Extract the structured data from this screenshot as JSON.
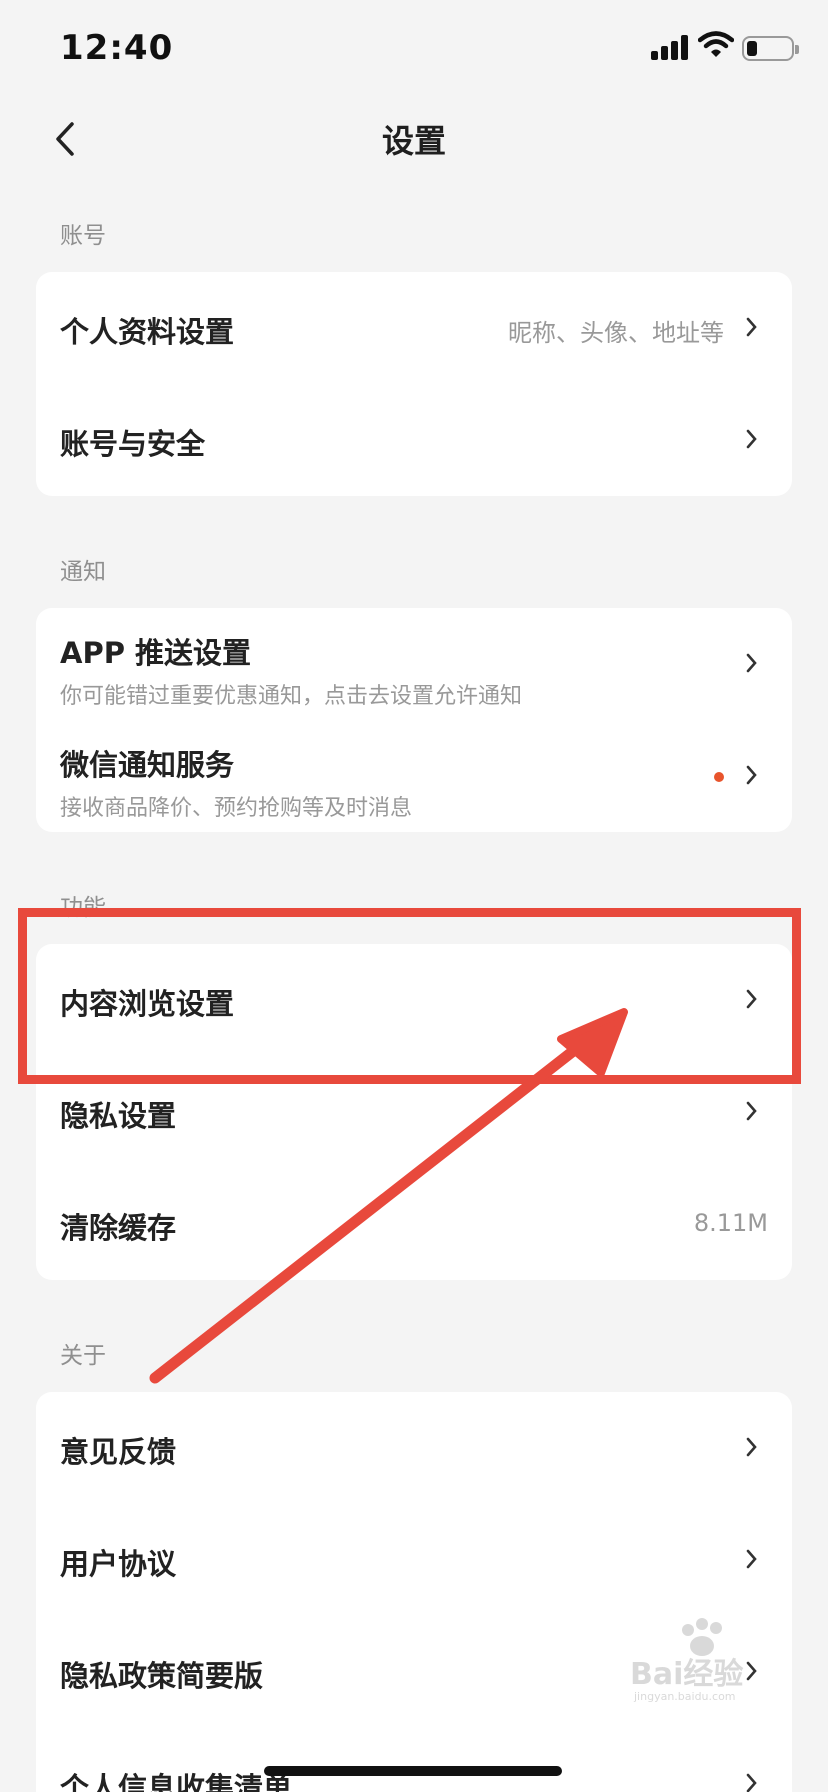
{
  "status_bar": {
    "time": "12:40"
  },
  "nav": {
    "title": "设置"
  },
  "sections": {
    "account": {
      "label": "账号",
      "rows": [
        {
          "title": "个人资料设置",
          "value": "昵称、头像、地址等"
        },
        {
          "title": "账号与安全"
        }
      ]
    },
    "notify": {
      "label": "通知",
      "rows": [
        {
          "title": "APP 推送设置",
          "sub": "你可能错过重要优惠通知，点击去设置允许通知"
        },
        {
          "title": "微信通知服务",
          "sub": "接收商品降价、预约抢购等及时消息"
        }
      ]
    },
    "features": {
      "label": "功能",
      "rows": [
        {
          "title": "内容浏览设置"
        },
        {
          "title": "隐私设置"
        },
        {
          "title": "清除缓存",
          "value": "8.11M"
        }
      ]
    },
    "about": {
      "label": "关于",
      "rows": [
        {
          "title": "意见反馈"
        },
        {
          "title": "用户协议"
        },
        {
          "title": "隐私政策简要版"
        },
        {
          "title": "个人信息收集清单"
        }
      ]
    }
  },
  "colors": {
    "annotation_red": "#e8493c",
    "badge_dot": "#e8542c",
    "background": "#f4f4f4"
  },
  "watermark": {
    "text": "Bai经验",
    "sub": "jingyan.baidu.com"
  }
}
